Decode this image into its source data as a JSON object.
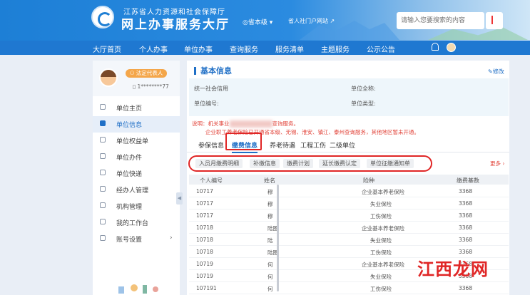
{
  "header": {
    "org": "江苏省人力资源和社会保障厅",
    "title": "网上办事服务大厅",
    "region": "◎省本级",
    "region_caret": "▾",
    "portal_link": "省人社门户网站",
    "portal_icon": "↗",
    "search_placeholder": "请输入您要搜索的内容"
  },
  "nav": {
    "items": [
      "大厅首页",
      "个人办事",
      "单位办事",
      "查询服务",
      "服务清单",
      "主题服务",
      "公示公告"
    ]
  },
  "sidebar": {
    "role_badge": "⚇ 法定代表人",
    "phone": "▯ 1********77",
    "items": [
      {
        "label": "单位主页",
        "icon": "home-icon"
      },
      {
        "label": "单位信息",
        "icon": "document-icon",
        "active": true
      },
      {
        "label": "单位权益单",
        "icon": "heart-icon"
      },
      {
        "label": "单位办件",
        "icon": "file-icon"
      },
      {
        "label": "单位快递",
        "icon": "truck-icon"
      },
      {
        "label": "经办人管理",
        "icon": "user-icon"
      },
      {
        "label": "机构管理",
        "icon": "building-icon"
      },
      {
        "label": "我的工作台",
        "icon": "image-icon"
      },
      {
        "label": "账号设置",
        "icon": "gear-icon",
        "has_children": true
      }
    ],
    "expand_arrow": "›",
    "collapse_arrow": "◀"
  },
  "basic_info": {
    "title": "基本信息",
    "edit": "✎修改",
    "fields": {
      "credit_code_label": "统一社会信用",
      "unit_name_label": "单位全称:",
      "unit_no_label": "单位编号:",
      "unit_type_label": "单位类型:"
    }
  },
  "notice": {
    "line1": "说明：机关事业",
    "line1_tail": "查询服务。",
    "line2": "企业职工养老保险已开通省本级、无锡、淮安、镇江、泰州查询服务，其他地区暂未开通。"
  },
  "tabs": {
    "items": [
      "参保信息",
      "缴费信息",
      "养老待遇",
      "工程工伤",
      "二级单位"
    ],
    "active_index": 1
  },
  "subtabs": {
    "items": [
      "入员月缴费明细",
      "补缴信息",
      "缴费计划",
      "延长缴费认定",
      "单位征缴通知单"
    ],
    "more": "更多 ›"
  },
  "table": {
    "columns": [
      "个人编号",
      "姓名",
      "险种",
      "缴费基数"
    ],
    "rows": [
      {
        "id": "10717",
        "name": "穆",
        "type": "企业基本养老保险",
        "base": "3368"
      },
      {
        "id": "10717",
        "name": "穆",
        "type": "失业保险",
        "base": "3368"
      },
      {
        "id": "10717",
        "name": "穆",
        "type": "工伤保险",
        "base": "3368"
      },
      {
        "id": "10718",
        "name": "陆图",
        "type": "企业基本养老保险",
        "base": "3368"
      },
      {
        "id": "10718",
        "name": "陆",
        "type": "失业保险",
        "base": "3368"
      },
      {
        "id": "10718",
        "name": "陆图",
        "type": "工伤保险",
        "base": "3368"
      },
      {
        "id": "10719",
        "name": "何",
        "type": "企业基本养老保险",
        "base": "3368"
      },
      {
        "id": "10719",
        "name": "何",
        "type": "失业保险",
        "base": "3368"
      },
      {
        "id": "107191",
        "name": "何",
        "type": "工伤保险",
        "base": "3368"
      }
    ]
  },
  "watermark": "江西龙网",
  "colors": {
    "primary": "#1f78d1",
    "highlight": "#e02626",
    "badge": "#f4a64a"
  }
}
